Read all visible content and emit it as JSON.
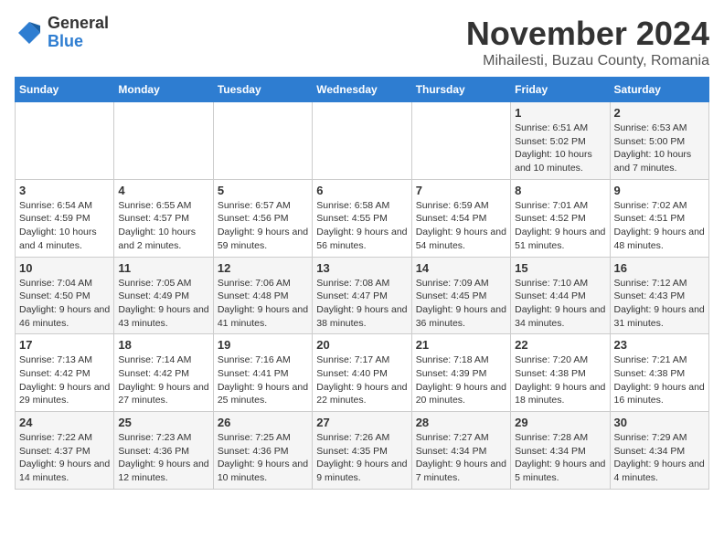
{
  "header": {
    "logo_line1": "General",
    "logo_line2": "Blue",
    "month_title": "November 2024",
    "location": "Mihailesti, Buzau County, Romania"
  },
  "weekdays": [
    "Sunday",
    "Monday",
    "Tuesday",
    "Wednesday",
    "Thursday",
    "Friday",
    "Saturday"
  ],
  "weeks": [
    [
      {
        "day": "",
        "info": ""
      },
      {
        "day": "",
        "info": ""
      },
      {
        "day": "",
        "info": ""
      },
      {
        "day": "",
        "info": ""
      },
      {
        "day": "",
        "info": ""
      },
      {
        "day": "1",
        "info": "Sunrise: 6:51 AM\nSunset: 5:02 PM\nDaylight: 10 hours and 10 minutes."
      },
      {
        "day": "2",
        "info": "Sunrise: 6:53 AM\nSunset: 5:00 PM\nDaylight: 10 hours and 7 minutes."
      }
    ],
    [
      {
        "day": "3",
        "info": "Sunrise: 6:54 AM\nSunset: 4:59 PM\nDaylight: 10 hours and 4 minutes."
      },
      {
        "day": "4",
        "info": "Sunrise: 6:55 AM\nSunset: 4:57 PM\nDaylight: 10 hours and 2 minutes."
      },
      {
        "day": "5",
        "info": "Sunrise: 6:57 AM\nSunset: 4:56 PM\nDaylight: 9 hours and 59 minutes."
      },
      {
        "day": "6",
        "info": "Sunrise: 6:58 AM\nSunset: 4:55 PM\nDaylight: 9 hours and 56 minutes."
      },
      {
        "day": "7",
        "info": "Sunrise: 6:59 AM\nSunset: 4:54 PM\nDaylight: 9 hours and 54 minutes."
      },
      {
        "day": "8",
        "info": "Sunrise: 7:01 AM\nSunset: 4:52 PM\nDaylight: 9 hours and 51 minutes."
      },
      {
        "day": "9",
        "info": "Sunrise: 7:02 AM\nSunset: 4:51 PM\nDaylight: 9 hours and 48 minutes."
      }
    ],
    [
      {
        "day": "10",
        "info": "Sunrise: 7:04 AM\nSunset: 4:50 PM\nDaylight: 9 hours and 46 minutes."
      },
      {
        "day": "11",
        "info": "Sunrise: 7:05 AM\nSunset: 4:49 PM\nDaylight: 9 hours and 43 minutes."
      },
      {
        "day": "12",
        "info": "Sunrise: 7:06 AM\nSunset: 4:48 PM\nDaylight: 9 hours and 41 minutes."
      },
      {
        "day": "13",
        "info": "Sunrise: 7:08 AM\nSunset: 4:47 PM\nDaylight: 9 hours and 38 minutes."
      },
      {
        "day": "14",
        "info": "Sunrise: 7:09 AM\nSunset: 4:45 PM\nDaylight: 9 hours and 36 minutes."
      },
      {
        "day": "15",
        "info": "Sunrise: 7:10 AM\nSunset: 4:44 PM\nDaylight: 9 hours and 34 minutes."
      },
      {
        "day": "16",
        "info": "Sunrise: 7:12 AM\nSunset: 4:43 PM\nDaylight: 9 hours and 31 minutes."
      }
    ],
    [
      {
        "day": "17",
        "info": "Sunrise: 7:13 AM\nSunset: 4:42 PM\nDaylight: 9 hours and 29 minutes."
      },
      {
        "day": "18",
        "info": "Sunrise: 7:14 AM\nSunset: 4:42 PM\nDaylight: 9 hours and 27 minutes."
      },
      {
        "day": "19",
        "info": "Sunrise: 7:16 AM\nSunset: 4:41 PM\nDaylight: 9 hours and 25 minutes."
      },
      {
        "day": "20",
        "info": "Sunrise: 7:17 AM\nSunset: 4:40 PM\nDaylight: 9 hours and 22 minutes."
      },
      {
        "day": "21",
        "info": "Sunrise: 7:18 AM\nSunset: 4:39 PM\nDaylight: 9 hours and 20 minutes."
      },
      {
        "day": "22",
        "info": "Sunrise: 7:20 AM\nSunset: 4:38 PM\nDaylight: 9 hours and 18 minutes."
      },
      {
        "day": "23",
        "info": "Sunrise: 7:21 AM\nSunset: 4:38 PM\nDaylight: 9 hours and 16 minutes."
      }
    ],
    [
      {
        "day": "24",
        "info": "Sunrise: 7:22 AM\nSunset: 4:37 PM\nDaylight: 9 hours and 14 minutes."
      },
      {
        "day": "25",
        "info": "Sunrise: 7:23 AM\nSunset: 4:36 PM\nDaylight: 9 hours and 12 minutes."
      },
      {
        "day": "26",
        "info": "Sunrise: 7:25 AM\nSunset: 4:36 PM\nDaylight: 9 hours and 10 minutes."
      },
      {
        "day": "27",
        "info": "Sunrise: 7:26 AM\nSunset: 4:35 PM\nDaylight: 9 hours and 9 minutes."
      },
      {
        "day": "28",
        "info": "Sunrise: 7:27 AM\nSunset: 4:34 PM\nDaylight: 9 hours and 7 minutes."
      },
      {
        "day": "29",
        "info": "Sunrise: 7:28 AM\nSunset: 4:34 PM\nDaylight: 9 hours and 5 minutes."
      },
      {
        "day": "30",
        "info": "Sunrise: 7:29 AM\nSunset: 4:34 PM\nDaylight: 9 hours and 4 minutes."
      }
    ]
  ]
}
